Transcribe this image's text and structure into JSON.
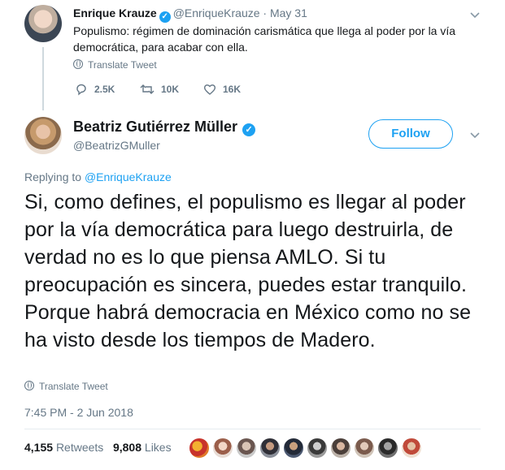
{
  "parent_tweet": {
    "author_name": "Enrique Krauze",
    "handle_and_date": "@EnriqueKrauze · May 31",
    "text": "Populismo: régimen de dominación carismática que llega al poder por la vía democrática, para acabar con ella.",
    "translate_label": "Translate Tweet",
    "replies": "2.5K",
    "retweets": "10K",
    "likes": "16K"
  },
  "main_tweet": {
    "author_name": "Beatriz Gutiérrez Müller",
    "handle": "@BeatrizGMuller",
    "follow_label": "Follow",
    "replying_prefix": "Replying to ",
    "replying_handle": "@EnriqueKrauze",
    "text": "Si, como defines, el populismo es llegar al poder por la vía democrática para luego destruirla, de verdad no es lo que piensa AMLO. Si tu preocupación es sincera, puedes estar tranquilo. Porque habrá democracia en México como no se ha visto desde los tiempos de Madero.",
    "translate_label": "Translate Tweet",
    "timestamp": "7:45 PM - 2 Jun 2018",
    "retweet_count": "4,155",
    "retweet_label": "Retweets",
    "like_count": "9,808",
    "like_label": "Likes"
  },
  "icons": {
    "verified": "verified-badge-icon",
    "caret": "chevron-down-icon",
    "reply": "reply-icon",
    "retweet": "retweet-icon",
    "like": "heart-icon",
    "translate": "globe-icon"
  },
  "colors": {
    "accent": "#1da1f2",
    "secondary_text": "#657786",
    "primary_text": "#14171a"
  }
}
